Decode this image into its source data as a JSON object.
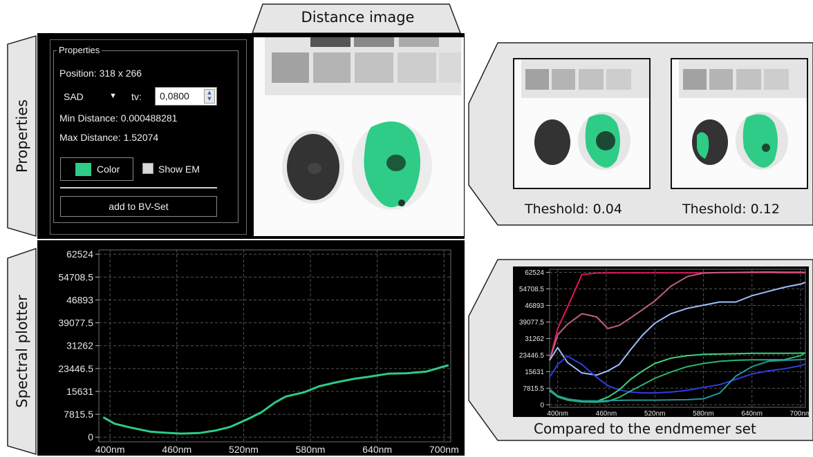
{
  "labels": {
    "distance_image": "Distance image",
    "properties_side": "Properties",
    "spectral_side": "Spectral plotter",
    "threshold_1": "Theshold: 0.04",
    "threshold_2": "Theshold: 0.12",
    "compared": "Compared to the endmemer set"
  },
  "properties_panel": {
    "group_title": "Properties",
    "position": "Position: 318 x 266",
    "metric": "SAD",
    "tv_label": "tv:",
    "tv_value": "0,0800",
    "min_distance": "Min Distance: 0.000488281",
    "max_distance": "Max Distance: 1.52074",
    "color_button": "Color",
    "show_em": "Show EM",
    "add_button": "add to BV-Set"
  },
  "colors": {
    "accent_green": "#2ecc87",
    "panel_bg": "#000000",
    "tab_fill": "#e6e6e6"
  },
  "chart_data": [
    {
      "type": "line",
      "x": [
        394,
        404,
        418,
        436,
        450,
        464,
        480,
        494,
        508,
        524,
        536,
        548,
        558,
        574,
        588,
        604,
        620,
        632,
        650,
        666,
        684,
        704
      ],
      "series": [
        {
          "color": "#2ecc87",
          "values": [
            6800,
            4600,
            3300,
            1900,
            1500,
            1200,
            1400,
            2200,
            3500,
            6200,
            8500,
            11800,
            13900,
            15300,
            17400,
            18800,
            20000,
            20600,
            21700,
            21800,
            22400,
            24600
          ]
        }
      ],
      "xlim": [
        390,
        706
      ],
      "ylim": [
        -1600,
        64000
      ],
      "y_ticks": [
        "62524",
        "54708.5",
        "46893",
        "39077.5",
        "31262",
        "23446.5",
        "15631",
        "7815.5",
        "0"
      ],
      "x_ticks": [
        "400nm",
        "460nm",
        "520nm",
        "580nm",
        "640nm",
        "700nm"
      ],
      "grid": true
    },
    {
      "type": "line",
      "x": [
        390,
        400,
        412,
        430,
        448,
        462,
        476,
        490,
        505,
        520,
        540,
        560,
        580,
        600,
        620,
        640,
        660,
        680,
        700,
        706
      ],
      "series": [
        {
          "color": "#e0145a",
          "values": [
            21000,
            36000,
            46000,
            61500,
            62200,
            62300,
            62300,
            62300,
            62300,
            62300,
            62300,
            62300,
            62300,
            62400,
            62400,
            62400,
            62400,
            62300,
            62300,
            62300
          ]
        },
        {
          "color": "#c0607e",
          "values": [
            21000,
            33000,
            38000,
            43000,
            41500,
            36000,
            37500,
            41000,
            45000,
            49000,
            56000,
            60500,
            62200,
            62400,
            62500,
            62600,
            62700,
            62600,
            62600,
            62500
          ]
        },
        {
          "color": "#9fbfff",
          "values": [
            21000,
            27000,
            20000,
            15000,
            14000,
            16000,
            19000,
            26000,
            33000,
            38500,
            43000,
            45500,
            47000,
            48500,
            48500,
            51500,
            53500,
            55500,
            57000,
            57800
          ]
        },
        {
          "color": "#2f3ee0",
          "values": [
            13000,
            19000,
            23000,
            19000,
            13000,
            9000,
            7000,
            6000,
            5600,
            5600,
            6000,
            6800,
            8200,
            9500,
            12000,
            14500,
            16000,
            17000,
            18500,
            19300
          ]
        },
        {
          "color": "#3ed47e",
          "values": [
            6500,
            4200,
            2800,
            1500,
            1600,
            3600,
            7000,
            12000,
            16000,
            19500,
            22000,
            23200,
            23800,
            24000,
            24100,
            24300,
            24300,
            24300,
            24400,
            24500
          ]
        },
        {
          "color": "#2ab870",
          "values": [
            6700,
            3700,
            2200,
            1300,
            1200,
            1600,
            3500,
            6500,
            9500,
            12500,
            15500,
            18000,
            19500,
            20500,
            21000,
            21200,
            21200,
            21300,
            23200,
            24600
          ]
        },
        {
          "color": "#229a9a",
          "values": [
            7400,
            4200,
            2700,
            1900,
            1800,
            2000,
            2100,
            2200,
            2200,
            2200,
            2300,
            2400,
            2800,
            5500,
            13500,
            18000,
            20500,
            21000,
            21300,
            21500
          ]
        }
      ],
      "xlim": [
        390,
        706
      ],
      "ylim": [
        -1200,
        64000
      ],
      "y_ticks": [
        "62524",
        "54708.5",
        "46893",
        "39077.5",
        "31262",
        "23446.5",
        "15631",
        "7815.5",
        "0"
      ],
      "x_ticks": [
        "400nm",
        "460nm",
        "520nm",
        "580nm",
        "640nm",
        "700nm"
      ],
      "grid": true
    }
  ]
}
